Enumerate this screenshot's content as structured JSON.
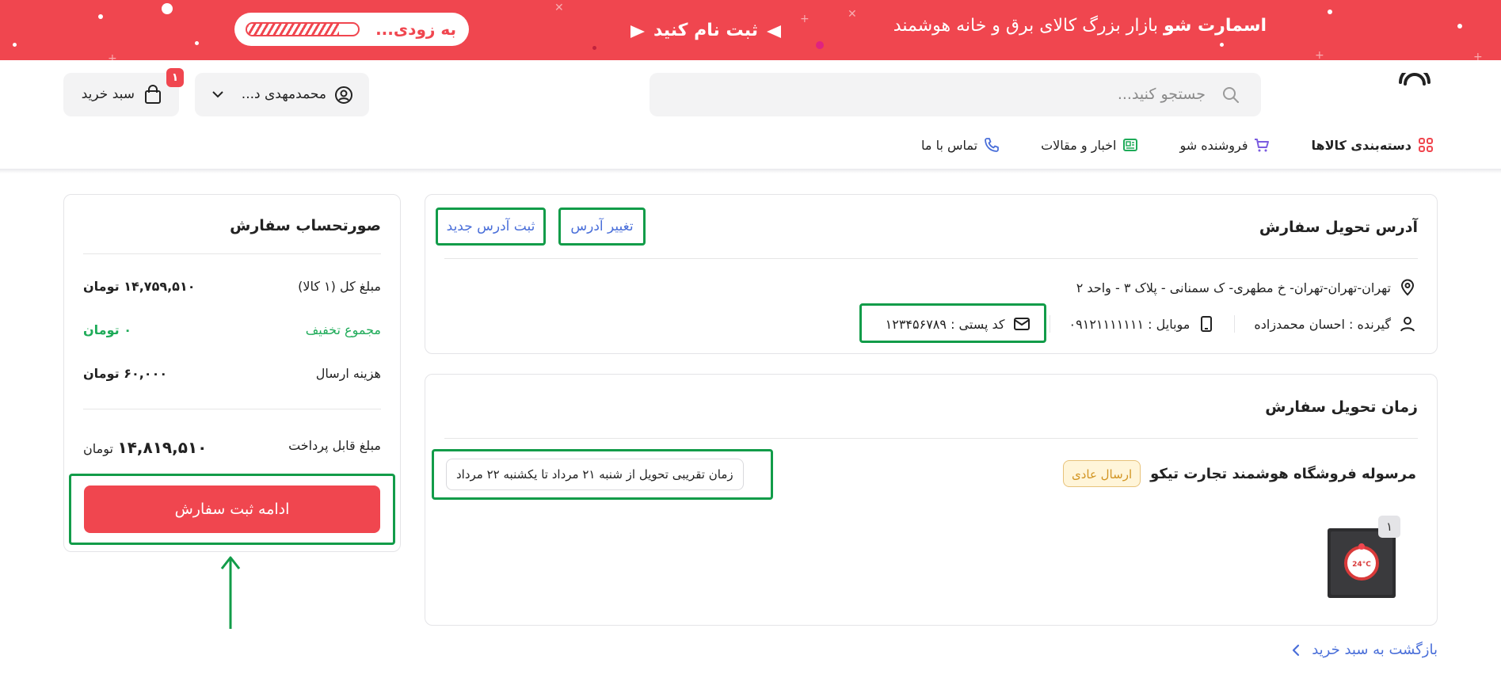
{
  "promo": {
    "brand_bold": "اسمارت شو",
    "brand_text": "بازار بزرگ کالای برق و خانه هوشمند",
    "register": "ثبت نام کنید",
    "soon": "به زودی...",
    "progress_fraction": 0.83,
    "bg_color": "#f0464f"
  },
  "header": {
    "logo_text": "smartsho",
    "search_placeholder": "جستجو کنید...",
    "user_name": "محمدمهدی د...",
    "cart_label": "سبد خرید",
    "cart_count": "۱"
  },
  "nav": {
    "items": [
      {
        "label": "دسته‌بندی کالاها",
        "icon": "grid-icon",
        "color": "#f0464f"
      },
      {
        "label": "فروشنده شو",
        "icon": "cart-icon",
        "color": "#7b5ce0"
      },
      {
        "label": "اخبار و مقالات",
        "icon": "news-icon",
        "color": "#1fab59"
      },
      {
        "label": "تماس با ما",
        "icon": "phone-icon",
        "color": "#4a6fd9"
      }
    ]
  },
  "address": {
    "title": "آدرس تحویل سفارش",
    "change_btn": "تغییر آدرس",
    "new_btn": "ثبت آدرس جدید",
    "line": "تهران-تهران-تهران- خ مطهری- ک سمنانی - پلاک ۳ - واحد ۲",
    "recipient": "گیرنده : احسان محمدزاده",
    "mobile": "موبایل : ۰۹۱۲۱۱۱۱۱۱۱",
    "postal": "کد پستی : ۱۲۳۴۵۶۷۸۹"
  },
  "delivery": {
    "title": "زمان تحویل سفارش",
    "shop": "مرسوله فروشگاه هوشمند تجارت تیکو",
    "ship_tag": "ارسال عادی",
    "time": "زمان تقریبی تحویل از شنبه ۲۱ مرداد تا یکشنبه ۲۲ مرداد",
    "qty": "۱",
    "product_display": "24°C"
  },
  "invoice": {
    "title": "صورتحساب سفارش",
    "rows": [
      {
        "label": "مبلغ کل (۱ کالا)",
        "value": "۱۴,۷۵۹,۵۱۰ تومان"
      },
      {
        "label": "مجموع تخفیف",
        "value": "۰ تومان"
      },
      {
        "label": "هزینه ارسال",
        "value": "۶۰,۰۰۰ تومان"
      }
    ],
    "payable_label": "مبلغ قابل پرداخت",
    "payable_value": "۱۴,۸۱۹,۵۱۰",
    "payable_currency": "تومان",
    "continue_btn": "ادامه ثبت سفارش"
  },
  "back_link": "بازگشت به سبد خرید",
  "colors": {
    "accent_red": "#f0464f",
    "link_blue": "#4a6fd9",
    "annotation_green": "#129c49",
    "discount_green": "#1fab59"
  }
}
